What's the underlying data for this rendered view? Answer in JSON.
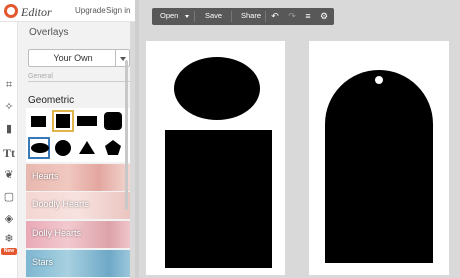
{
  "app": {
    "brand": "Editor",
    "upgrade": "Upgrade",
    "signin": "Sign in"
  },
  "tools": [
    {
      "name": "crop-tool-icon",
      "glyph": "⌗"
    },
    {
      "name": "effects-wand-icon",
      "glyph": "✧"
    },
    {
      "name": "touch-up-icon",
      "glyph": "▮"
    },
    {
      "name": "text-tool-icon",
      "glyph": "Tt"
    },
    {
      "name": "overlays-butterfly-icon",
      "glyph": "❦"
    },
    {
      "name": "frames-icon",
      "glyph": "▢"
    },
    {
      "name": "textures-icon",
      "glyph": "◈"
    },
    {
      "name": "seasonal-icon",
      "glyph": "❄"
    }
  ],
  "tool_badge": "New",
  "overlays": {
    "title": "Overlays",
    "source_select": "Your Own",
    "section_label": "General",
    "group_title": "Geometric",
    "shapes": [
      "square",
      "square-selected",
      "wide-rectangle",
      "rounded-square",
      "oval",
      "circle",
      "triangle",
      "pentagon"
    ],
    "categories": [
      "Hearts",
      "Doodly Hearts",
      "Dolly Hearts",
      "Stars"
    ]
  },
  "toolbar": {
    "open": "Open",
    "save": "Save",
    "share": "Share"
  },
  "toolbar_icons": [
    "undo-icon",
    "redo-icon",
    "layers-icon",
    "settings-gear-icon"
  ],
  "colors": {
    "brand": "#e4572e",
    "selected": "#e0b44c",
    "hover": "#3a79b7",
    "toolbar": "#585858"
  }
}
